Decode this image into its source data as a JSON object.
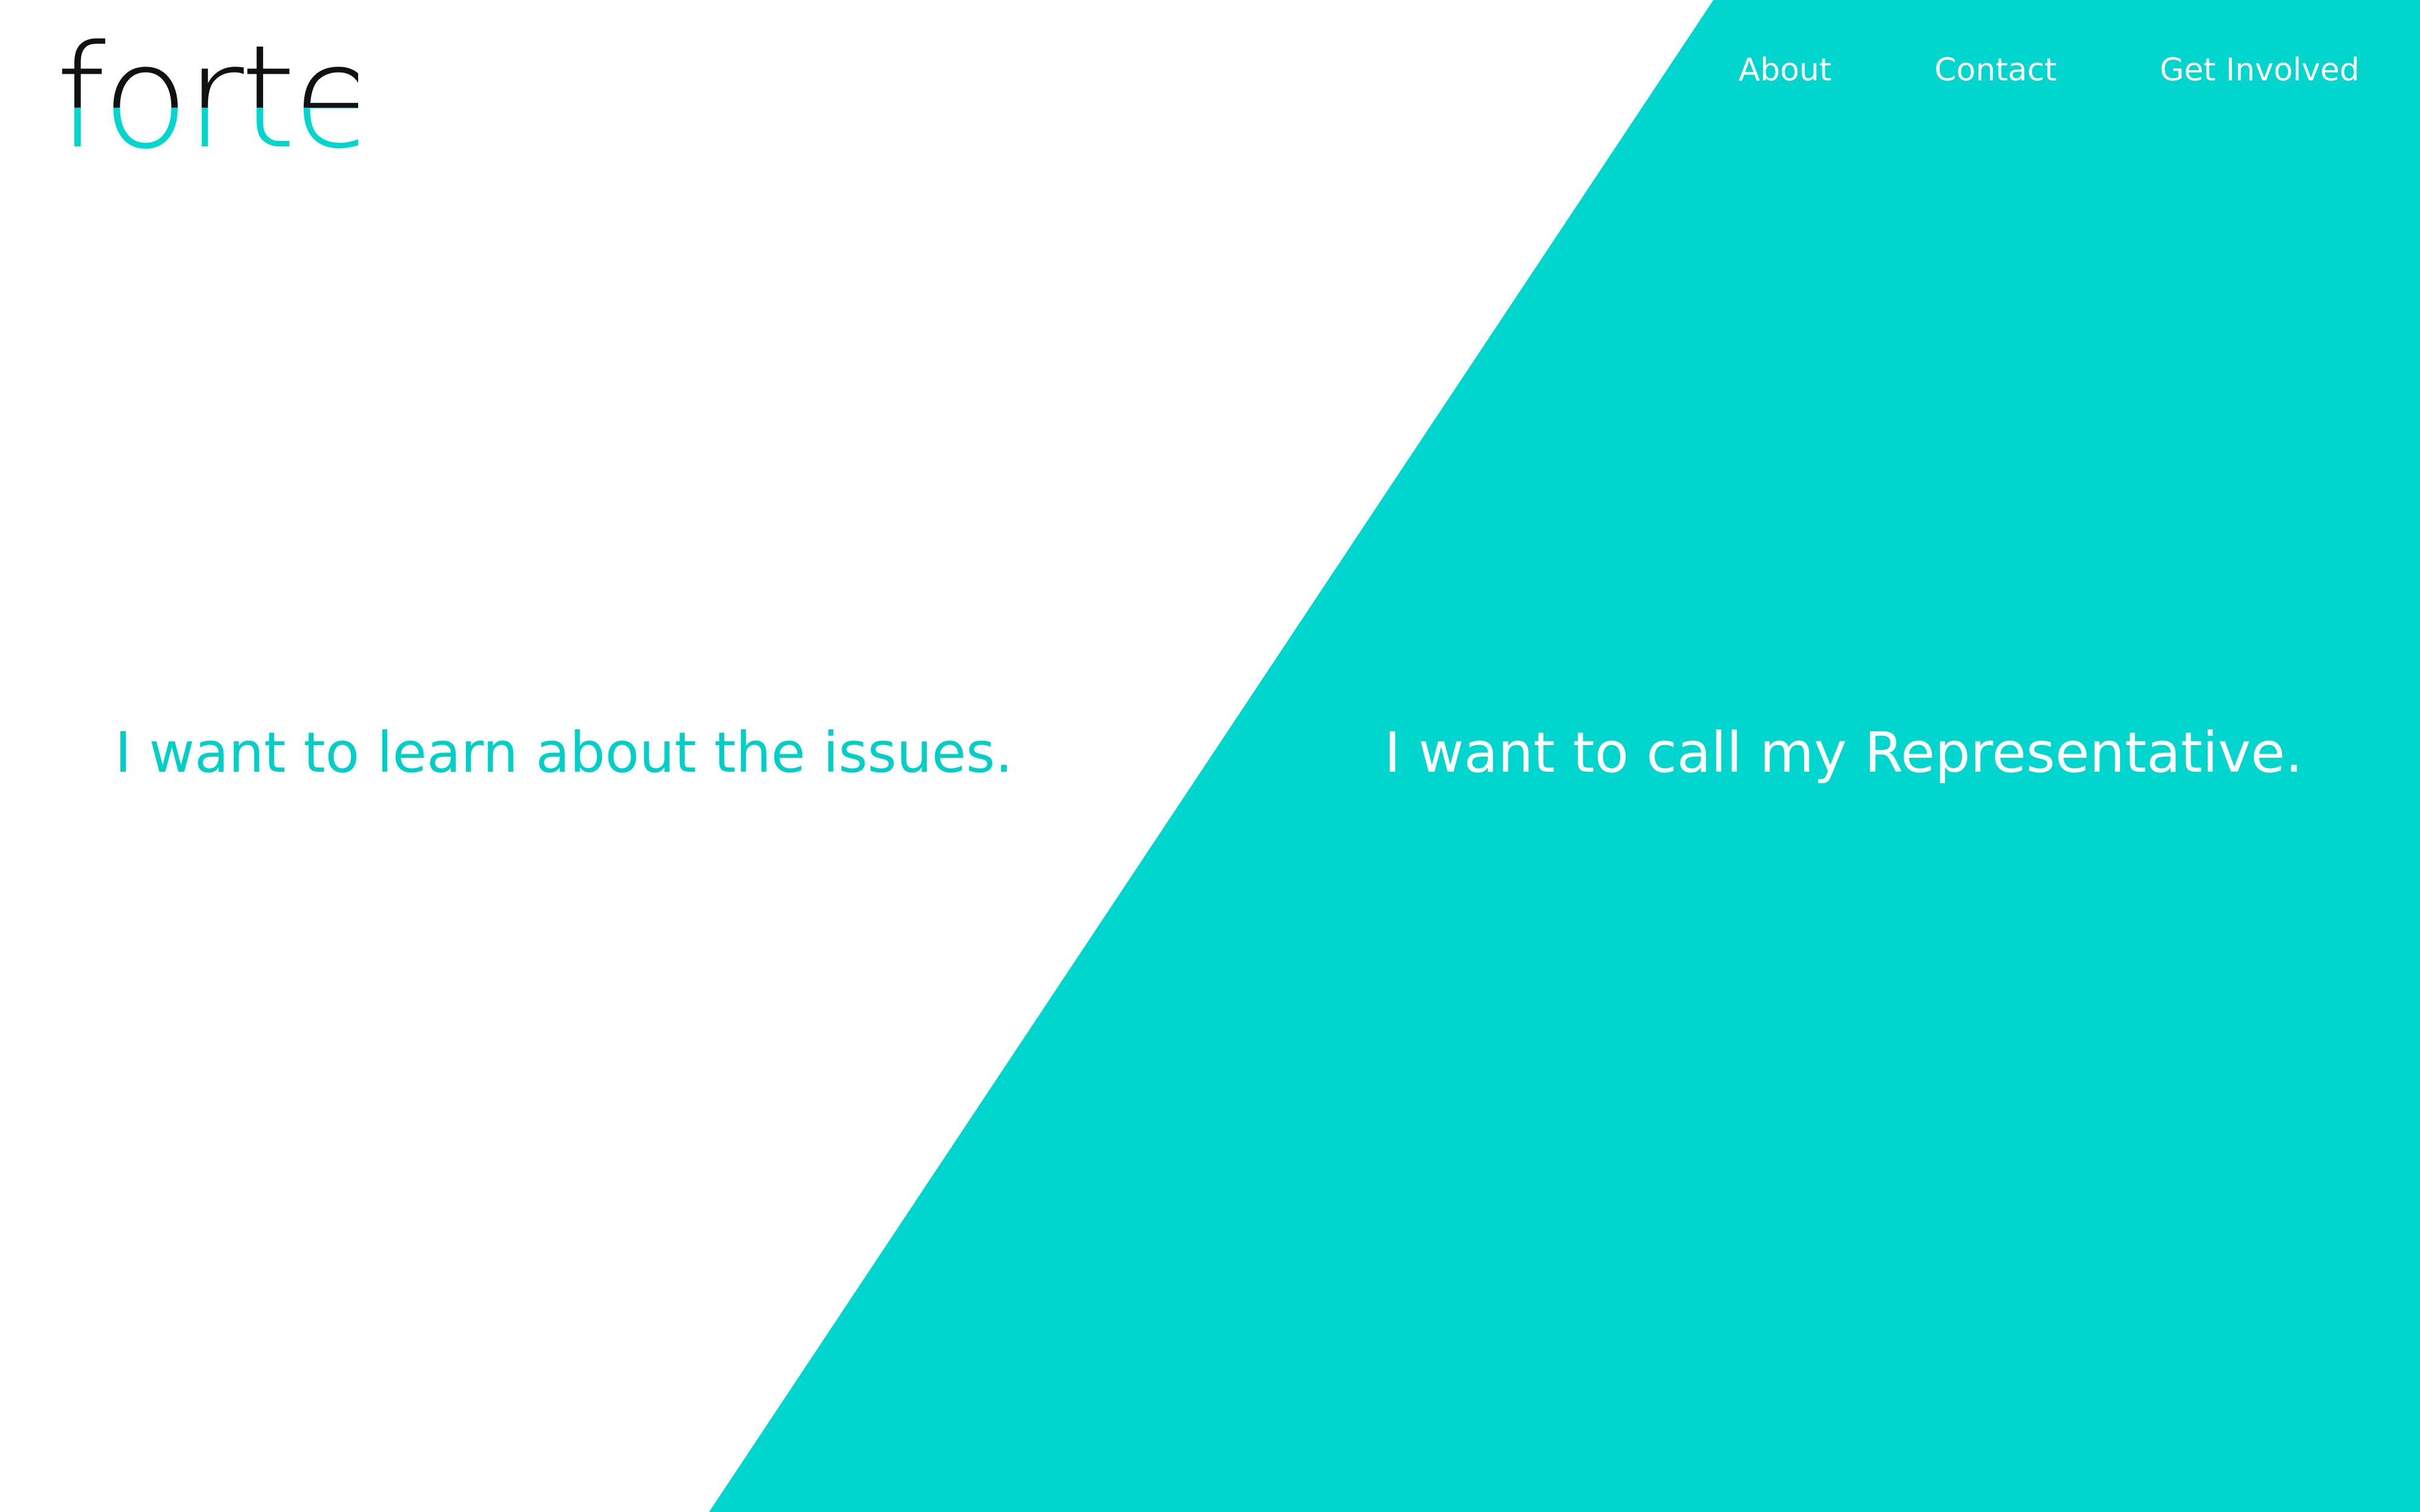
{
  "brand": {
    "logo_text": "forte",
    "accent_color": "#00D6CE",
    "ink_color": "#111111"
  },
  "nav": {
    "items": [
      {
        "label": "About"
      },
      {
        "label": "Contact"
      },
      {
        "label": "Get Involved"
      }
    ]
  },
  "hero": {
    "learn_label": "I want to learn about the issues.",
    "call_label": "I want to call my Representative."
  }
}
